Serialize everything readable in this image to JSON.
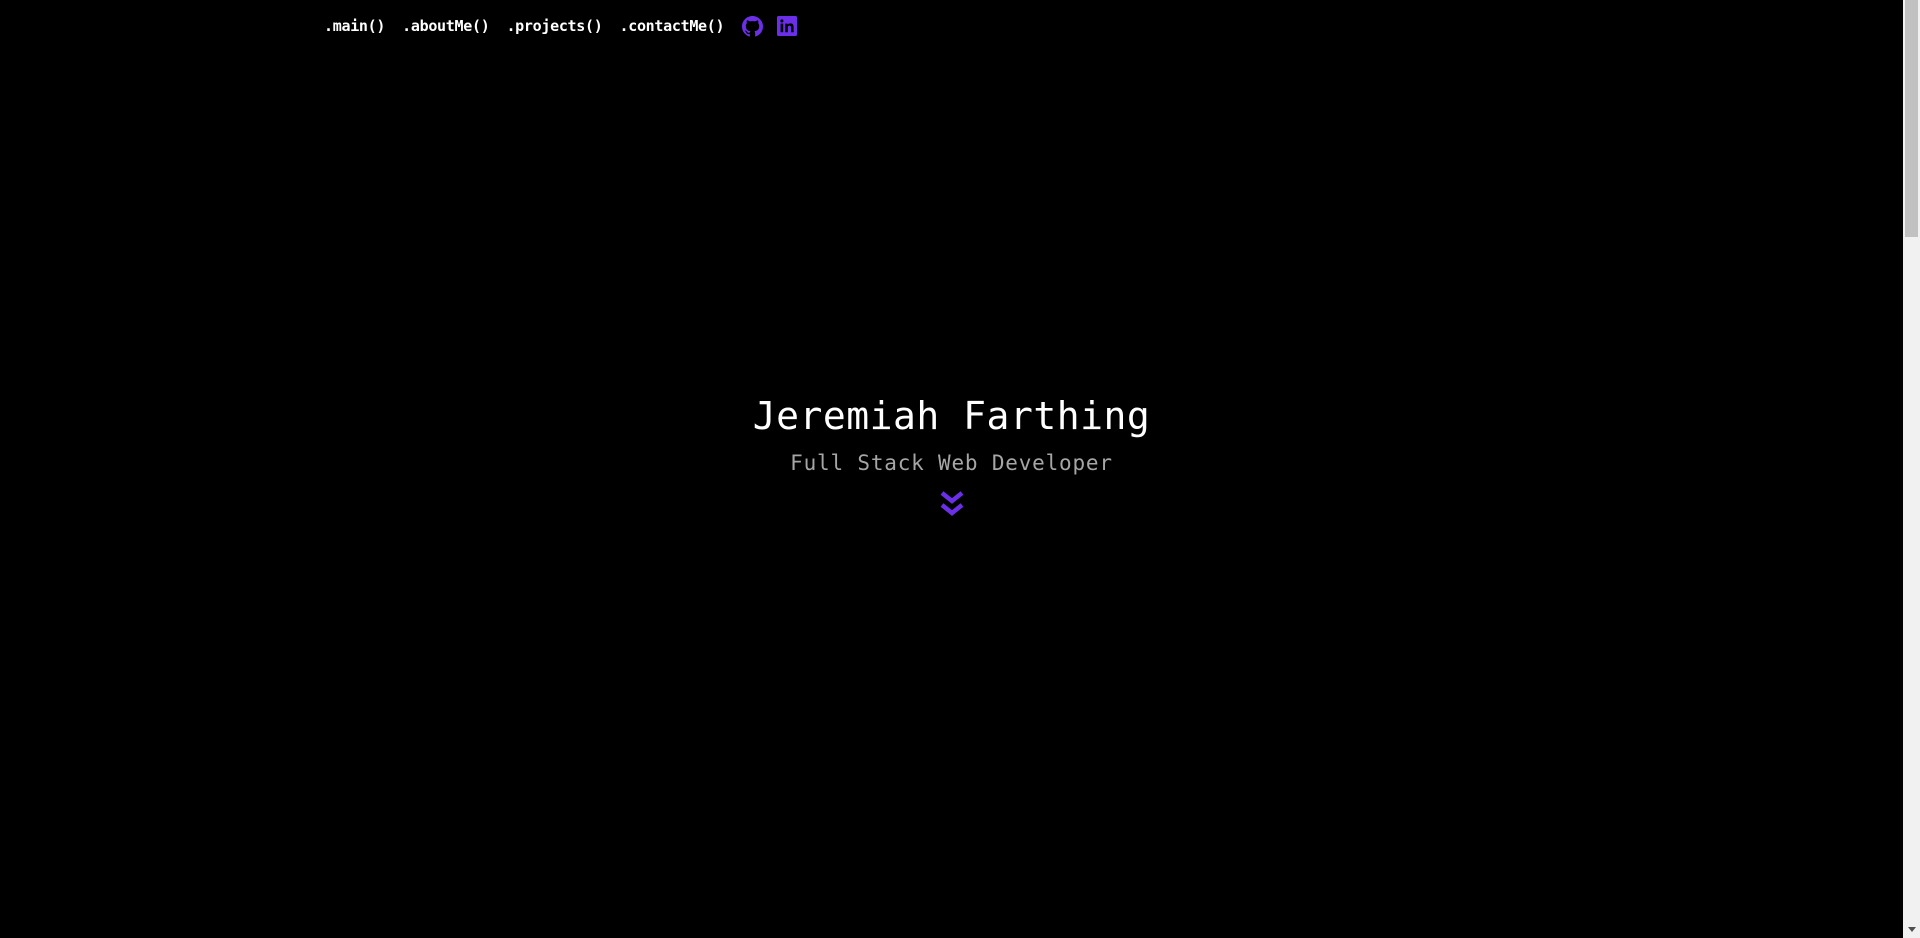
{
  "nav": {
    "links": [
      {
        "label": ".main()"
      },
      {
        "label": ".aboutMe()"
      },
      {
        "label": ".projects()"
      },
      {
        "label": ".contactMe()"
      }
    ],
    "icons": [
      {
        "name": "github-icon"
      },
      {
        "name": "linkedin-icon"
      }
    ]
  },
  "hero": {
    "name": "Jeremiah Farthing",
    "role": "Full Stack Web Developer",
    "scroll_icon": "double-chevron-down-icon"
  },
  "colors": {
    "background": "#000000",
    "text": "#ffffff",
    "subtitle": "#a6a6a6",
    "accent": "#6b2fe8"
  }
}
